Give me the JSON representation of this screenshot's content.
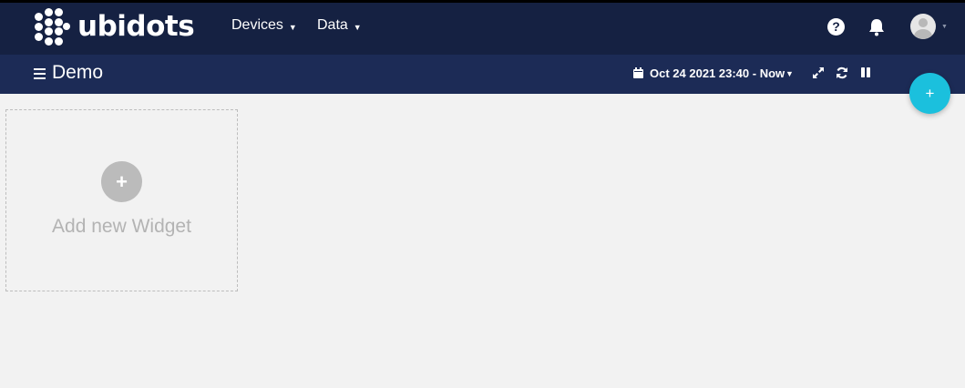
{
  "brand": {
    "name": "ubidots"
  },
  "nav": {
    "items": [
      {
        "label": "Devices"
      },
      {
        "label": "Data"
      }
    ]
  },
  "header": {
    "help_icon": "help-icon",
    "bell_icon": "bell-icon",
    "avatar_icon": "user-avatar"
  },
  "dashboard": {
    "title": "Demo",
    "date_range": "Oct 24 2021 23:40 - Now",
    "tools": [
      "fullscreen-icon",
      "refresh-icon",
      "pause-icon"
    ]
  },
  "fab": {
    "label": "+"
  },
  "widget": {
    "add_label": "Add new Widget",
    "plus": "+"
  },
  "colors": {
    "topbar": "#152142",
    "subbar": "#1c2b56",
    "accent": "#1bc0dd",
    "canvas": "#f2f2f2"
  }
}
